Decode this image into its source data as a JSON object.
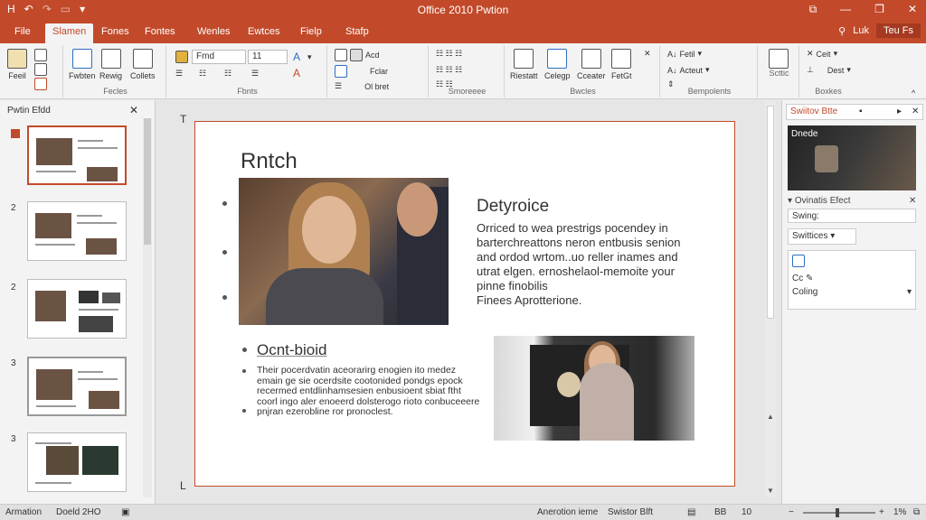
{
  "window": {
    "title": "Office 2010 Pwtion"
  },
  "qat": {
    "save": "H",
    "undo": "↶",
    "redo": "↷",
    "more": "▾"
  },
  "winbtns": {
    "ribbon_opts": "⧉",
    "minimize": "—",
    "restore": "❐",
    "close": "✕"
  },
  "tabs": [
    "File",
    "Slamen",
    "Fones",
    "Fontes",
    "Wenles",
    "Ewtces",
    "Fielp",
    "Stafp"
  ],
  "tabbar_right": {
    "tell": "Luk",
    "share": "Teu Fs"
  },
  "ribbon": {
    "clipboard": {
      "paste": "Feeil",
      "label": ""
    },
    "slides": {
      "new": "Fwbten",
      "layout": "Rewig",
      "reset": "Collets",
      "label": "Fecles"
    },
    "font": {
      "font_name": "Fmd",
      "font_size": "11",
      "label": "Fbnts"
    },
    "paragraph": {
      "top": "Acd",
      "middle": "Fclar",
      "bottom": "Ol bret",
      "label": ""
    },
    "drawing": {
      "label": "Smoreeee"
    },
    "editing": {
      "a": "Riestatt",
      "b": "Celegp",
      "c": "Cceater",
      "d": "FetGt",
      "label": "Bwcles"
    },
    "designer": {
      "font": "Fetil",
      "arrange": "Acteut",
      "label": "Bempolents"
    },
    "view": {
      "label": "Scttic"
    },
    "far": {
      "cut": "Ceit",
      "dest": "Dest",
      "label": "Boxkes"
    }
  },
  "left_pane": {
    "title": "Pwtin Efdd",
    "close": "✕",
    "thumbnails": [
      {
        "num": ""
      },
      {
        "num": "2"
      },
      {
        "num": "2"
      },
      {
        "num": "3"
      },
      {
        "num": "3"
      }
    ]
  },
  "slide": {
    "title": "Rntch",
    "heading2": "Detyroice",
    "paragraph": "Orriced to wea prestrigs pocendey in barterchreattons neron entbusis senion and ordod wrtom..uo reller inames and utrat elgen. ernoshelaol-memoite your pinne finobilis",
    "paragraph2": "Finees Aprotterione.",
    "heading3": "Ocnt-bioid",
    "small_text": "Their pocerdvatin aceorarirg enogien ito medez emain ge sie ocerdsite cootonided pondgs epock recermed entdlinhamsesien enbusioent sbiat ftht coorl ingo aler enoeerd dolsterogo rioto conbuceeere pnjran ezerobline ror pronoclest.",
    "ruler_left": "T",
    "ruler_bottom": "L"
  },
  "right_pane": {
    "head_title": "Swiitov Btte",
    "head_pin": "▪",
    "head_more": "▸",
    "head_close": "✕",
    "video_title": "Dnede",
    "row1": "Ovinatis Efect",
    "row1_close": "✕",
    "box1": "Swing:",
    "box2": "Swittices",
    "box2_more": "▾",
    "item1": "",
    "item2": "Cc",
    "item3": "Coling",
    "item3_more": "▾"
  },
  "status": {
    "left1": "Armation",
    "left2": "Doeld 2HO",
    "right1": "Anerotion ieme",
    "right2": "Swistor Blft",
    "zoom": "1%",
    "fit": "⧉",
    "view_btns": [
      "▤",
      "BB",
      "10"
    ]
  }
}
